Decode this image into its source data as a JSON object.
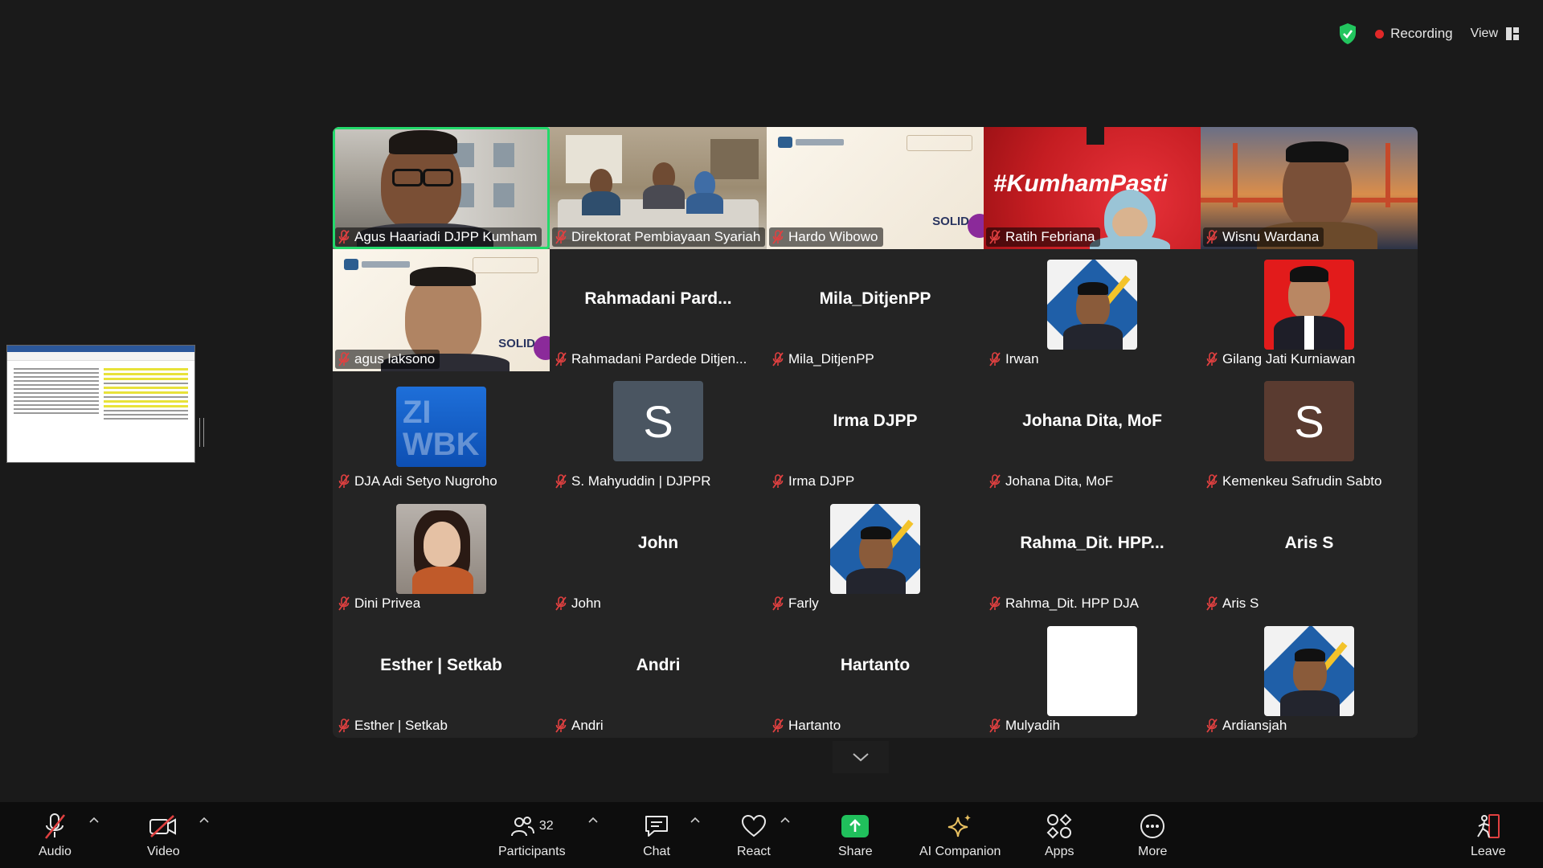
{
  "status": {
    "recording_label": "Recording",
    "view_label": "View"
  },
  "colors": {
    "active_speaker": "#23d96b",
    "muted_icon": "#e04040",
    "recording_dot": "#e02828",
    "share_button": "#20c05c"
  },
  "participants": [
    {
      "name": "Agus Haariadi DJPP Kumham",
      "type": "video",
      "scene": "man-outdoor",
      "active": true
    },
    {
      "name": "Direktorat Pembiayaan Syariah",
      "type": "video",
      "scene": "meeting-room"
    },
    {
      "name": "Hardo Wibowo",
      "type": "video",
      "scene": "banner-white",
      "banner_text": "SOLID"
    },
    {
      "name": "Ratih Febriana",
      "type": "video",
      "scene": "banner-red",
      "banner_text": "#KumhamPasti"
    },
    {
      "name": "Wisnu Wardana",
      "type": "video",
      "scene": "bridge"
    },
    {
      "name": "agus laksono",
      "type": "video",
      "scene": "banner-white-man",
      "banner_text": "SOLID"
    },
    {
      "name": "Rahmadani Pardede Ditjen...",
      "type": "name",
      "display": "Rahmadani  Pard..."
    },
    {
      "name": "Mila_DitjenPP",
      "type": "name",
      "display": "Mila_DitjenPP"
    },
    {
      "name": "Irwan",
      "type": "avatar",
      "avatar": "photo-frame-blue"
    },
    {
      "name": "Gilang Jati Kurniawan",
      "type": "avatar",
      "avatar": "photo-red"
    },
    {
      "name": "DJA Adi Setyo Nugroho",
      "type": "avatar",
      "avatar": "zi-wbk",
      "avatar_text": "ZI WBK"
    },
    {
      "name": "S. Mahyuddin | DJPPR",
      "type": "letter",
      "letter": "S",
      "color": "#4a5561"
    },
    {
      "name": "Irma DJPP",
      "type": "name",
      "display": "Irma DJPP"
    },
    {
      "name": "Johana Dita, MoF",
      "type": "name",
      "display": "Johana Dita, MoF"
    },
    {
      "name": "Kemenkeu Safrudin Sabto",
      "type": "letter",
      "letter": "S",
      "color": "#5a3b30"
    },
    {
      "name": "Dini Privea",
      "type": "avatar",
      "avatar": "photo-woman"
    },
    {
      "name": "John",
      "type": "name",
      "display": "John"
    },
    {
      "name": "Farly",
      "type": "avatar",
      "avatar": "photo-frame-blue"
    },
    {
      "name": "Rahma_Dit. HPP DJA",
      "type": "name",
      "display": "Rahma_Dit.  HPP..."
    },
    {
      "name": "Aris S",
      "type": "name",
      "display": "Aris S"
    },
    {
      "name": "Esther | Setkab",
      "type": "name",
      "display": "Esther | Setkab"
    },
    {
      "name": "Andri",
      "type": "name",
      "display": "Andri"
    },
    {
      "name": "Hartanto",
      "type": "name",
      "display": "Hartanto"
    },
    {
      "name": "Mulyadih",
      "type": "avatar",
      "avatar": "white"
    },
    {
      "name": "Ardiansjah",
      "type": "avatar",
      "avatar": "photo-frame-blue"
    }
  ],
  "toolbar": {
    "audio": "Audio",
    "video": "Video",
    "participants": "Participants",
    "participant_count": "32",
    "chat": "Chat",
    "react": "React",
    "share": "Share",
    "ai_companion": "AI Companion",
    "apps": "Apps",
    "more": "More",
    "leave": "Leave"
  }
}
